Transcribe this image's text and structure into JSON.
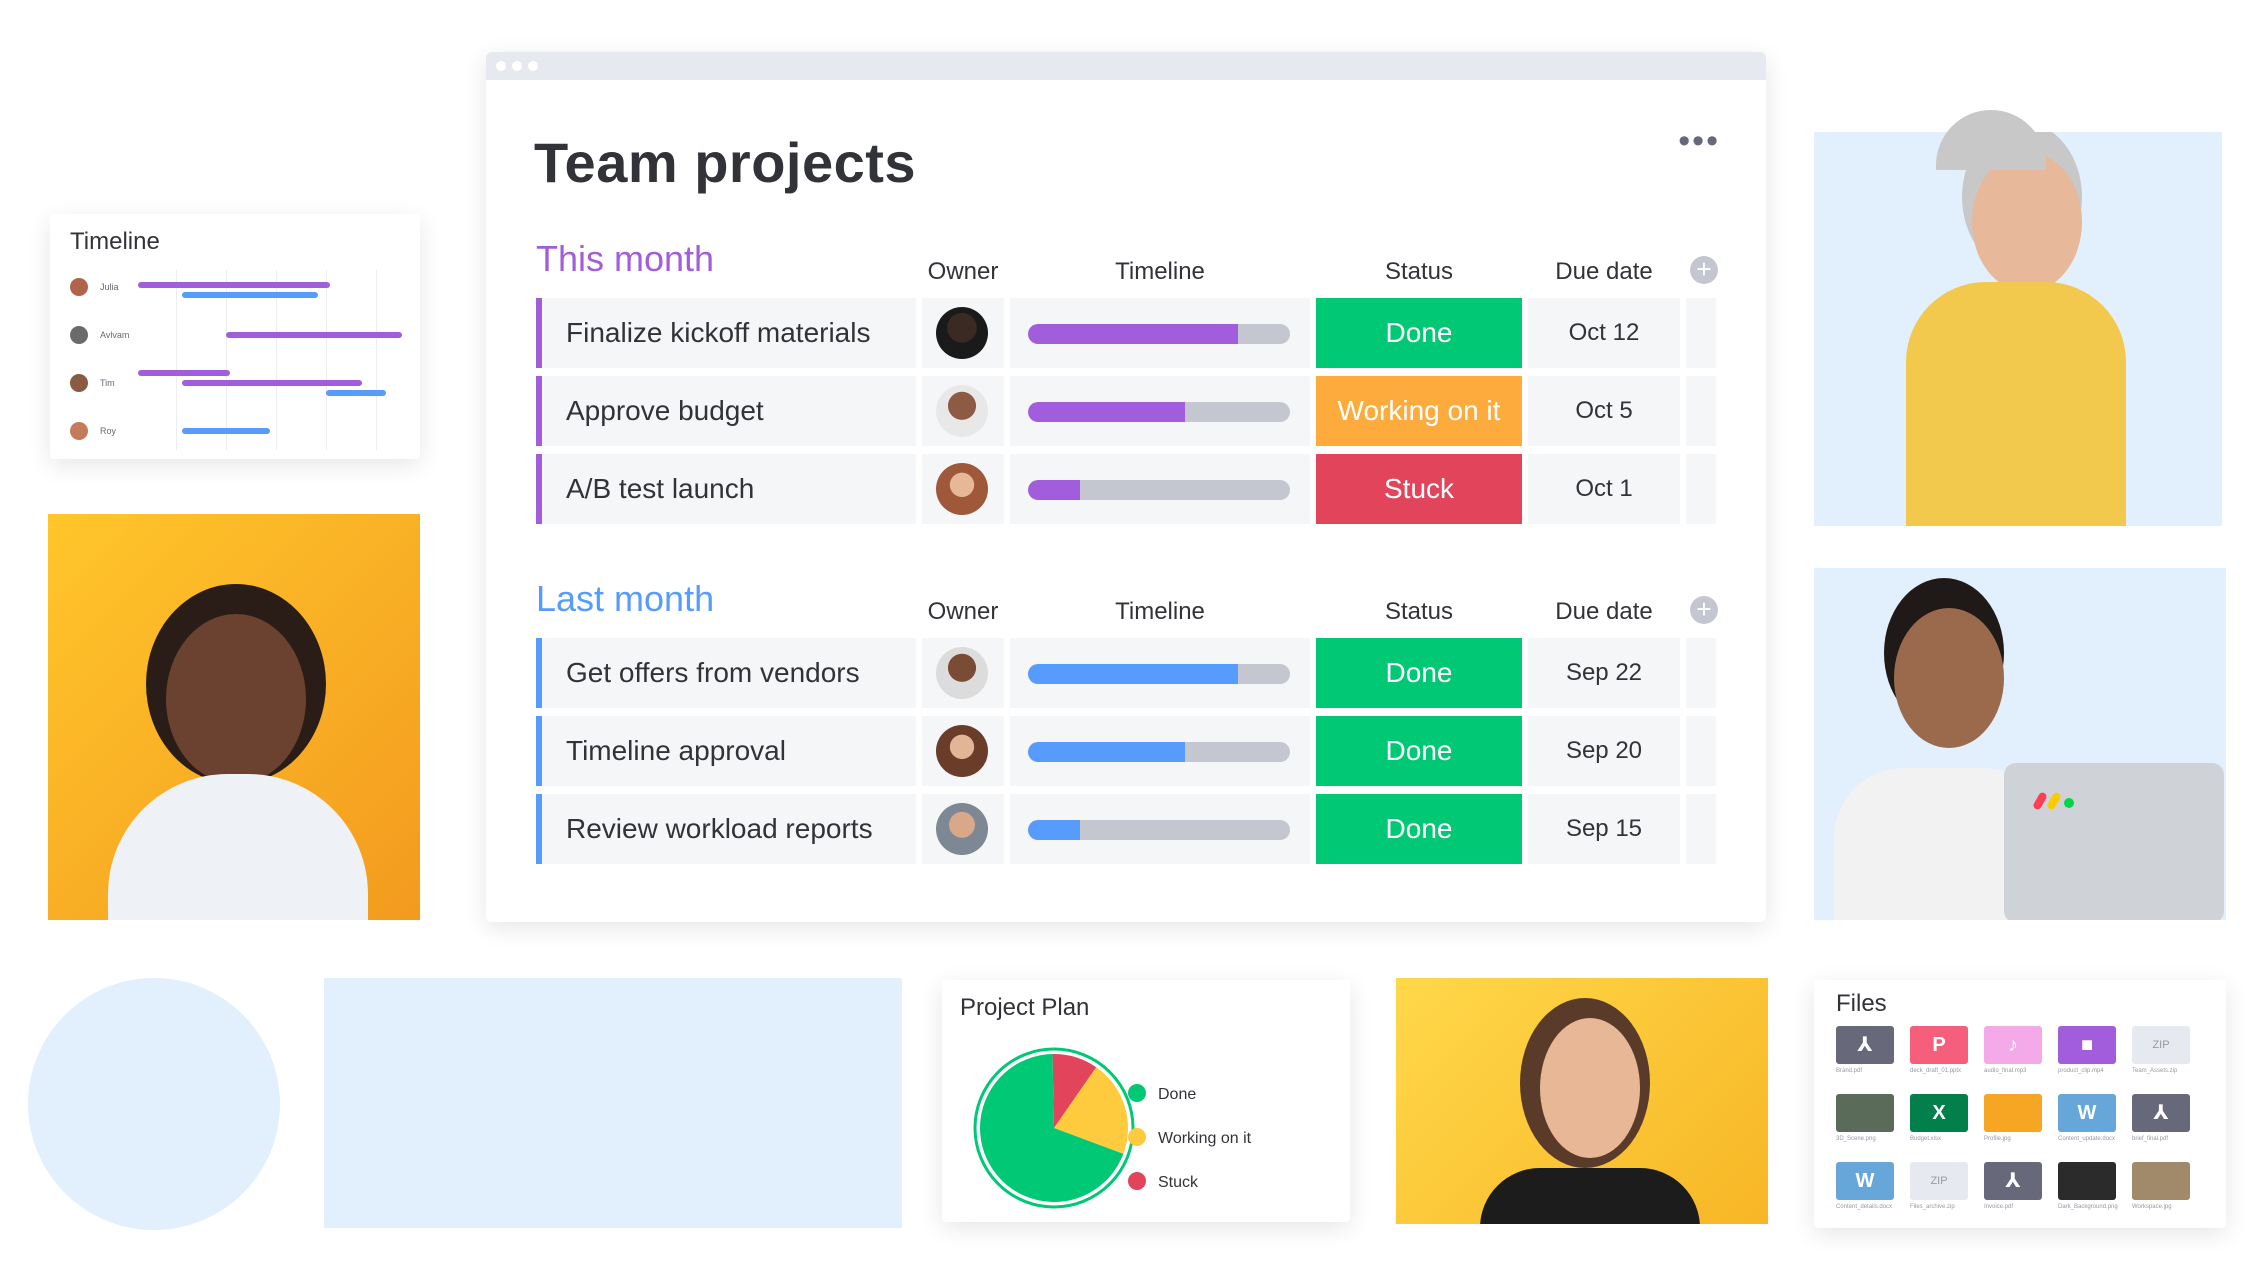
{
  "board": {
    "title": "Team projects",
    "menu": "•••",
    "add_symbol": "+",
    "groups": [
      {
        "title": "This month",
        "color": "#a25ddc",
        "headers": [
          "Owner",
          "Timeline",
          "Status",
          "Due date"
        ],
        "rows": [
          {
            "name": "Finalize kickoff materials",
            "progress": 0.8,
            "status": "Done",
            "status_color": "#00c875",
            "due": "Oct 12"
          },
          {
            "name": "Approve budget",
            "progress": 0.6,
            "status": "Working on it",
            "status_color": "#fdab3d",
            "due": "Oct 5"
          },
          {
            "name": "A/B test launch",
            "progress": 0.2,
            "status": "Stuck",
            "status_color": "#e2445c",
            "due": "Oct 1"
          }
        ]
      },
      {
        "title": "Last month",
        "color": "#579bfc",
        "headers": [
          "Owner",
          "Timeline",
          "Status",
          "Due date"
        ],
        "rows": [
          {
            "name": "Get offers from vendors",
            "progress": 0.8,
            "status": "Done",
            "status_color": "#00c875",
            "due": "Sep 22"
          },
          {
            "name": "Timeline approval",
            "progress": 0.6,
            "status": "Done",
            "status_color": "#00c875",
            "due": "Sep 20"
          },
          {
            "name": "Review workload reports",
            "progress": 0.2,
            "status": "Done",
            "status_color": "#00c875",
            "due": "Sep 15"
          }
        ]
      }
    ]
  },
  "timeline_card": {
    "title": "Timeline",
    "people": [
      "Julia",
      "Avlvam",
      "Tim",
      "Roy"
    ]
  },
  "project_plan": {
    "title": "Project Plan",
    "legend": [
      {
        "label": "Done",
        "color": "#00c875"
      },
      {
        "label": "Working on it",
        "color": "#fdcb3d"
      },
      {
        "label": "Stuck",
        "color": "#e2445c"
      }
    ],
    "slices": [
      {
        "label": "Done",
        "fraction": 0.69
      },
      {
        "label": "Working on it",
        "fraction": 0.21
      },
      {
        "label": "Stuck",
        "fraction": 0.1
      }
    ]
  },
  "files": {
    "title": "Files",
    "tiles": [
      {
        "label": "",
        "color": "#676879",
        "icon": "pdf-icon",
        "glyph": "⅄",
        "caption": "Brand.pdf"
      },
      {
        "label": "P",
        "color": "#f65f7c",
        "icon": "powerpoint-icon",
        "glyph": "",
        "caption": "deck_draft_01.pptx"
      },
      {
        "label": "",
        "color": "#f4a9e8",
        "icon": "audio-icon",
        "glyph": "♪",
        "caption": "audio_final.mp3"
      },
      {
        "label": "",
        "color": "#a25ddc",
        "icon": "video-icon",
        "glyph": "■",
        "caption": "product_clip.mp4"
      },
      {
        "label": "ZIP",
        "color": "#e6e9ef",
        "icon": "zip-icon",
        "glyph": "",
        "caption": "Team_Assets.zip"
      },
      {
        "label": "",
        "color": "#5a6b5a",
        "icon": "image-icon",
        "glyph": "",
        "caption": "3D_Scene.png"
      },
      {
        "label": "X",
        "color": "#037f4c",
        "icon": "excel-icon",
        "glyph": "",
        "caption": "Budget.xlsx"
      },
      {
        "label": "",
        "color": "#f6a623",
        "icon": "photo-icon",
        "glyph": "",
        "caption": "Profile.jpg"
      },
      {
        "label": "W",
        "color": "#66a6d9",
        "icon": "word-icon",
        "glyph": "",
        "caption": "Content_update.docx"
      },
      {
        "label": "",
        "color": "#676879",
        "icon": "pdf-icon",
        "glyph": "⅄",
        "caption": "brief_final.pdf"
      },
      {
        "label": "W",
        "color": "#66a6d9",
        "icon": "word-icon",
        "glyph": "",
        "caption": "Content_details.docx"
      },
      {
        "label": "ZIP",
        "color": "#e6e9ef",
        "icon": "zip-icon",
        "glyph": "",
        "caption": "Files_archive.zip"
      },
      {
        "label": "",
        "color": "#676879",
        "icon": "pdf-icon",
        "glyph": "⅄",
        "caption": "Invoice.pdf"
      },
      {
        "label": "",
        "color": "#2b2b2b",
        "icon": "image-icon",
        "glyph": "",
        "caption": "Dark_Background.png"
      },
      {
        "label": "",
        "color": "#a08a6a",
        "icon": "image-icon",
        "glyph": "",
        "caption": "Workspace.jpg"
      }
    ]
  },
  "colors": {
    "accent": "#a25ddc",
    "blue": "#579bfc",
    "neutral": "#c5c7d0",
    "cell": "#f5f6f8",
    "blob": "#e2effc",
    "yellow": "#f6b323"
  }
}
